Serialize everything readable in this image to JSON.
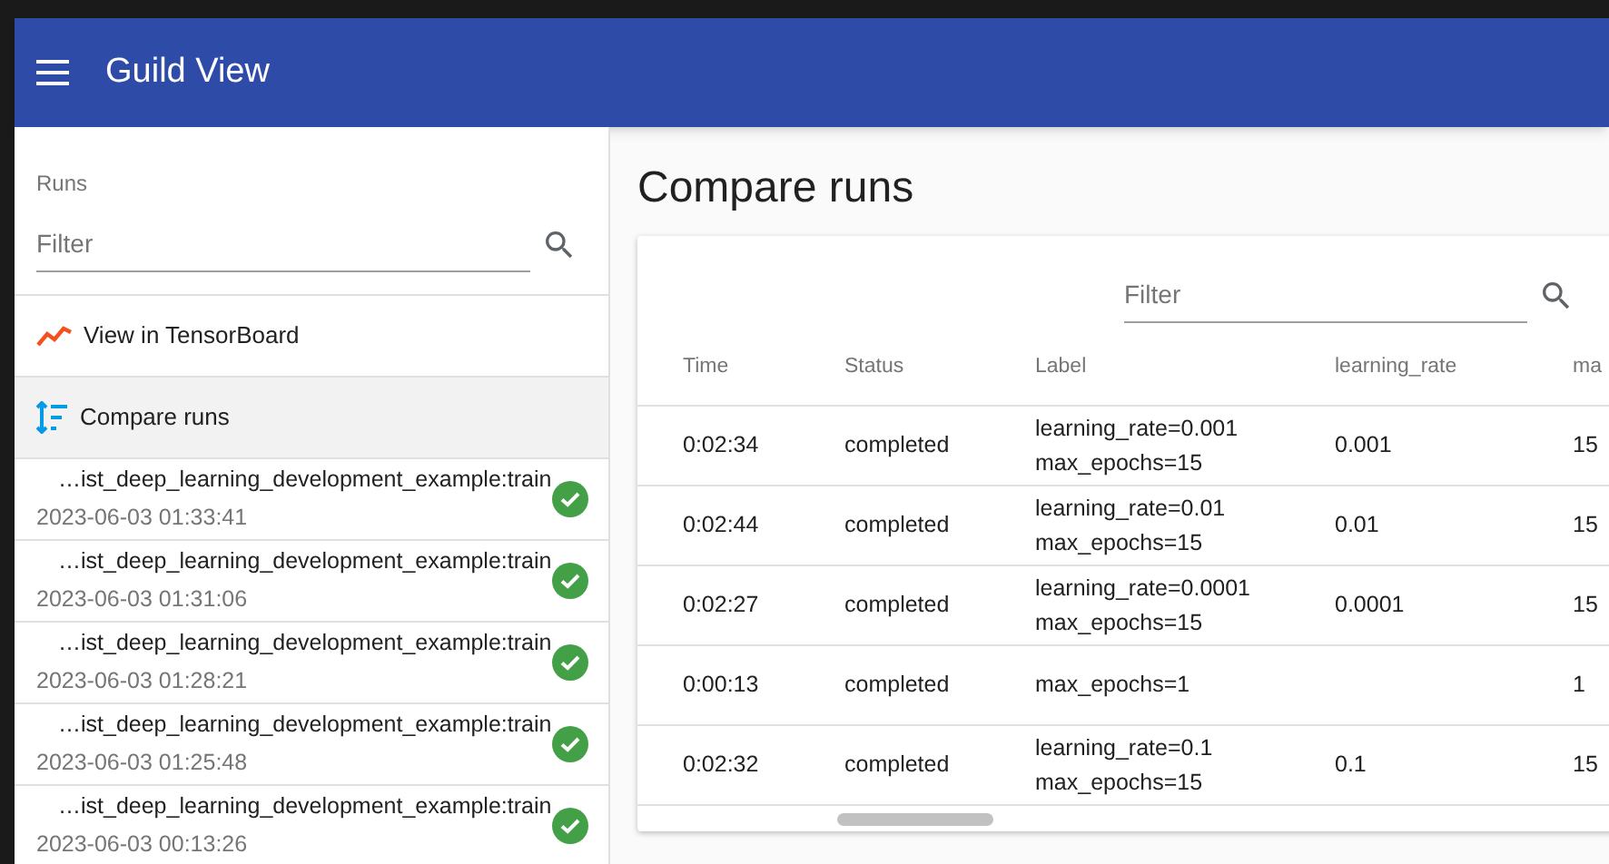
{
  "app_bar": {
    "title": "Guild View"
  },
  "sidebar": {
    "heading": "Runs",
    "filter": {
      "placeholder": "Filter"
    },
    "nav": [
      {
        "label": "View in TensorBoard",
        "kind": "tensorboard",
        "selected": false
      },
      {
        "label": "Compare runs",
        "kind": "compare",
        "selected": true
      }
    ],
    "runs": [
      {
        "name": "…ist_deep_learning_development_example:train",
        "time": "2023-06-03 01:33:41",
        "completed": true
      },
      {
        "name": "…ist_deep_learning_development_example:train",
        "time": "2023-06-03 01:31:06",
        "completed": true
      },
      {
        "name": "…ist_deep_learning_development_example:train",
        "time": "2023-06-03 01:28:21",
        "completed": true
      },
      {
        "name": "…ist_deep_learning_development_example:train",
        "time": "2023-06-03 01:25:48",
        "completed": true
      },
      {
        "name": "…ist_deep_learning_development_example:train",
        "time": "2023-06-03 00:13:26",
        "completed": true
      }
    ]
  },
  "main": {
    "title": "Compare runs",
    "filter": {
      "placeholder": "Filter"
    },
    "table": {
      "columns": [
        "Time",
        "Status",
        "Label",
        "learning_rate",
        "ma"
      ],
      "rows": [
        {
          "time": "0:02:34",
          "status": "completed",
          "label": [
            "learning_rate=0.001",
            "max_epochs=15"
          ],
          "learning_rate": "0.001",
          "max_epochs": "15"
        },
        {
          "time": "0:02:44",
          "status": "completed",
          "label": [
            "learning_rate=0.01",
            "max_epochs=15"
          ],
          "learning_rate": "0.01",
          "max_epochs": "15"
        },
        {
          "time": "0:02:27",
          "status": "completed",
          "label": [
            "learning_rate=0.0001",
            "max_epochs=15"
          ],
          "learning_rate": "0.0001",
          "max_epochs": "15"
        },
        {
          "time": "0:00:13",
          "status": "completed",
          "label": [
            "max_epochs=1"
          ],
          "max_epochs": "1"
        },
        {
          "time": "0:02:32",
          "status": "completed",
          "label": [
            "learning_rate=0.1",
            "max_epochs=15"
          ],
          "learning_rate": "0.1",
          "max_epochs": "15"
        }
      ]
    }
  }
}
